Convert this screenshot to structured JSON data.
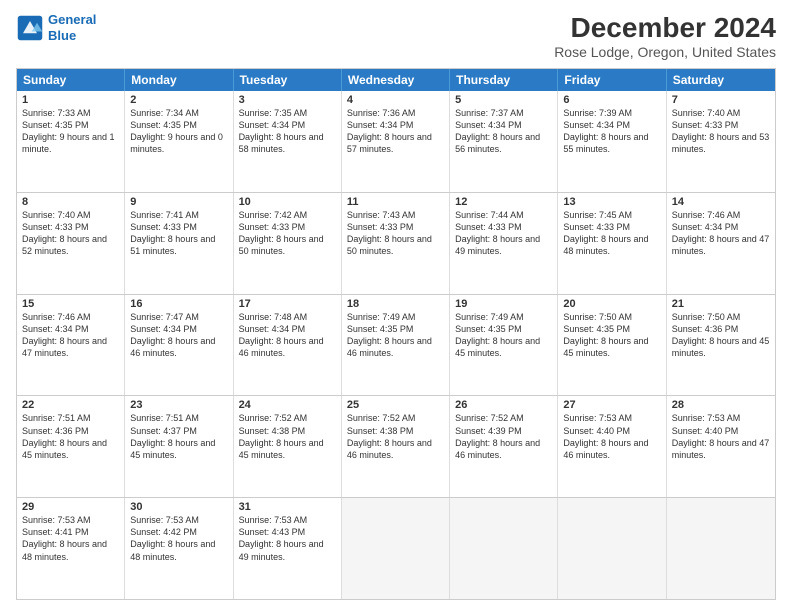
{
  "header": {
    "logo_line1": "General",
    "logo_line2": "Blue",
    "title": "December 2024",
    "subtitle": "Rose Lodge, Oregon, United States"
  },
  "days_of_week": [
    "Sunday",
    "Monday",
    "Tuesday",
    "Wednesday",
    "Thursday",
    "Friday",
    "Saturday"
  ],
  "weeks": [
    [
      {
        "day": "1",
        "rise": "Sunrise: 7:33 AM",
        "set": "Sunset: 4:35 PM",
        "daylight": "Daylight: 9 hours and 1 minute."
      },
      {
        "day": "2",
        "rise": "Sunrise: 7:34 AM",
        "set": "Sunset: 4:35 PM",
        "daylight": "Daylight: 9 hours and 0 minutes."
      },
      {
        "day": "3",
        "rise": "Sunrise: 7:35 AM",
        "set": "Sunset: 4:34 PM",
        "daylight": "Daylight: 8 hours and 58 minutes."
      },
      {
        "day": "4",
        "rise": "Sunrise: 7:36 AM",
        "set": "Sunset: 4:34 PM",
        "daylight": "Daylight: 8 hours and 57 minutes."
      },
      {
        "day": "5",
        "rise": "Sunrise: 7:37 AM",
        "set": "Sunset: 4:34 PM",
        "daylight": "Daylight: 8 hours and 56 minutes."
      },
      {
        "day": "6",
        "rise": "Sunrise: 7:39 AM",
        "set": "Sunset: 4:34 PM",
        "daylight": "Daylight: 8 hours and 55 minutes."
      },
      {
        "day": "7",
        "rise": "Sunrise: 7:40 AM",
        "set": "Sunset: 4:33 PM",
        "daylight": "Daylight: 8 hours and 53 minutes."
      }
    ],
    [
      {
        "day": "8",
        "rise": "Sunrise: 7:40 AM",
        "set": "Sunset: 4:33 PM",
        "daylight": "Daylight: 8 hours and 52 minutes."
      },
      {
        "day": "9",
        "rise": "Sunrise: 7:41 AM",
        "set": "Sunset: 4:33 PM",
        "daylight": "Daylight: 8 hours and 51 minutes."
      },
      {
        "day": "10",
        "rise": "Sunrise: 7:42 AM",
        "set": "Sunset: 4:33 PM",
        "daylight": "Daylight: 8 hours and 50 minutes."
      },
      {
        "day": "11",
        "rise": "Sunrise: 7:43 AM",
        "set": "Sunset: 4:33 PM",
        "daylight": "Daylight: 8 hours and 50 minutes."
      },
      {
        "day": "12",
        "rise": "Sunrise: 7:44 AM",
        "set": "Sunset: 4:33 PM",
        "daylight": "Daylight: 8 hours and 49 minutes."
      },
      {
        "day": "13",
        "rise": "Sunrise: 7:45 AM",
        "set": "Sunset: 4:33 PM",
        "daylight": "Daylight: 8 hours and 48 minutes."
      },
      {
        "day": "14",
        "rise": "Sunrise: 7:46 AM",
        "set": "Sunset: 4:34 PM",
        "daylight": "Daylight: 8 hours and 47 minutes."
      }
    ],
    [
      {
        "day": "15",
        "rise": "Sunrise: 7:46 AM",
        "set": "Sunset: 4:34 PM",
        "daylight": "Daylight: 8 hours and 47 minutes."
      },
      {
        "day": "16",
        "rise": "Sunrise: 7:47 AM",
        "set": "Sunset: 4:34 PM",
        "daylight": "Daylight: 8 hours and 46 minutes."
      },
      {
        "day": "17",
        "rise": "Sunrise: 7:48 AM",
        "set": "Sunset: 4:34 PM",
        "daylight": "Daylight: 8 hours and 46 minutes."
      },
      {
        "day": "18",
        "rise": "Sunrise: 7:49 AM",
        "set": "Sunset: 4:35 PM",
        "daylight": "Daylight: 8 hours and 46 minutes."
      },
      {
        "day": "19",
        "rise": "Sunrise: 7:49 AM",
        "set": "Sunset: 4:35 PM",
        "daylight": "Daylight: 8 hours and 45 minutes."
      },
      {
        "day": "20",
        "rise": "Sunrise: 7:50 AM",
        "set": "Sunset: 4:35 PM",
        "daylight": "Daylight: 8 hours and 45 minutes."
      },
      {
        "day": "21",
        "rise": "Sunrise: 7:50 AM",
        "set": "Sunset: 4:36 PM",
        "daylight": "Daylight: 8 hours and 45 minutes."
      }
    ],
    [
      {
        "day": "22",
        "rise": "Sunrise: 7:51 AM",
        "set": "Sunset: 4:36 PM",
        "daylight": "Daylight: 8 hours and 45 minutes."
      },
      {
        "day": "23",
        "rise": "Sunrise: 7:51 AM",
        "set": "Sunset: 4:37 PM",
        "daylight": "Daylight: 8 hours and 45 minutes."
      },
      {
        "day": "24",
        "rise": "Sunrise: 7:52 AM",
        "set": "Sunset: 4:38 PM",
        "daylight": "Daylight: 8 hours and 45 minutes."
      },
      {
        "day": "25",
        "rise": "Sunrise: 7:52 AM",
        "set": "Sunset: 4:38 PM",
        "daylight": "Daylight: 8 hours and 46 minutes."
      },
      {
        "day": "26",
        "rise": "Sunrise: 7:52 AM",
        "set": "Sunset: 4:39 PM",
        "daylight": "Daylight: 8 hours and 46 minutes."
      },
      {
        "day": "27",
        "rise": "Sunrise: 7:53 AM",
        "set": "Sunset: 4:40 PM",
        "daylight": "Daylight: 8 hours and 46 minutes."
      },
      {
        "day": "28",
        "rise": "Sunrise: 7:53 AM",
        "set": "Sunset: 4:40 PM",
        "daylight": "Daylight: 8 hours and 47 minutes."
      }
    ],
    [
      {
        "day": "29",
        "rise": "Sunrise: 7:53 AM",
        "set": "Sunset: 4:41 PM",
        "daylight": "Daylight: 8 hours and 48 minutes."
      },
      {
        "day": "30",
        "rise": "Sunrise: 7:53 AM",
        "set": "Sunset: 4:42 PM",
        "daylight": "Daylight: 8 hours and 48 minutes."
      },
      {
        "day": "31",
        "rise": "Sunrise: 7:53 AM",
        "set": "Sunset: 4:43 PM",
        "daylight": "Daylight: 8 hours and 49 minutes."
      },
      {
        "day": "",
        "rise": "",
        "set": "",
        "daylight": ""
      },
      {
        "day": "",
        "rise": "",
        "set": "",
        "daylight": ""
      },
      {
        "day": "",
        "rise": "",
        "set": "",
        "daylight": ""
      },
      {
        "day": "",
        "rise": "",
        "set": "",
        "daylight": ""
      }
    ]
  ]
}
